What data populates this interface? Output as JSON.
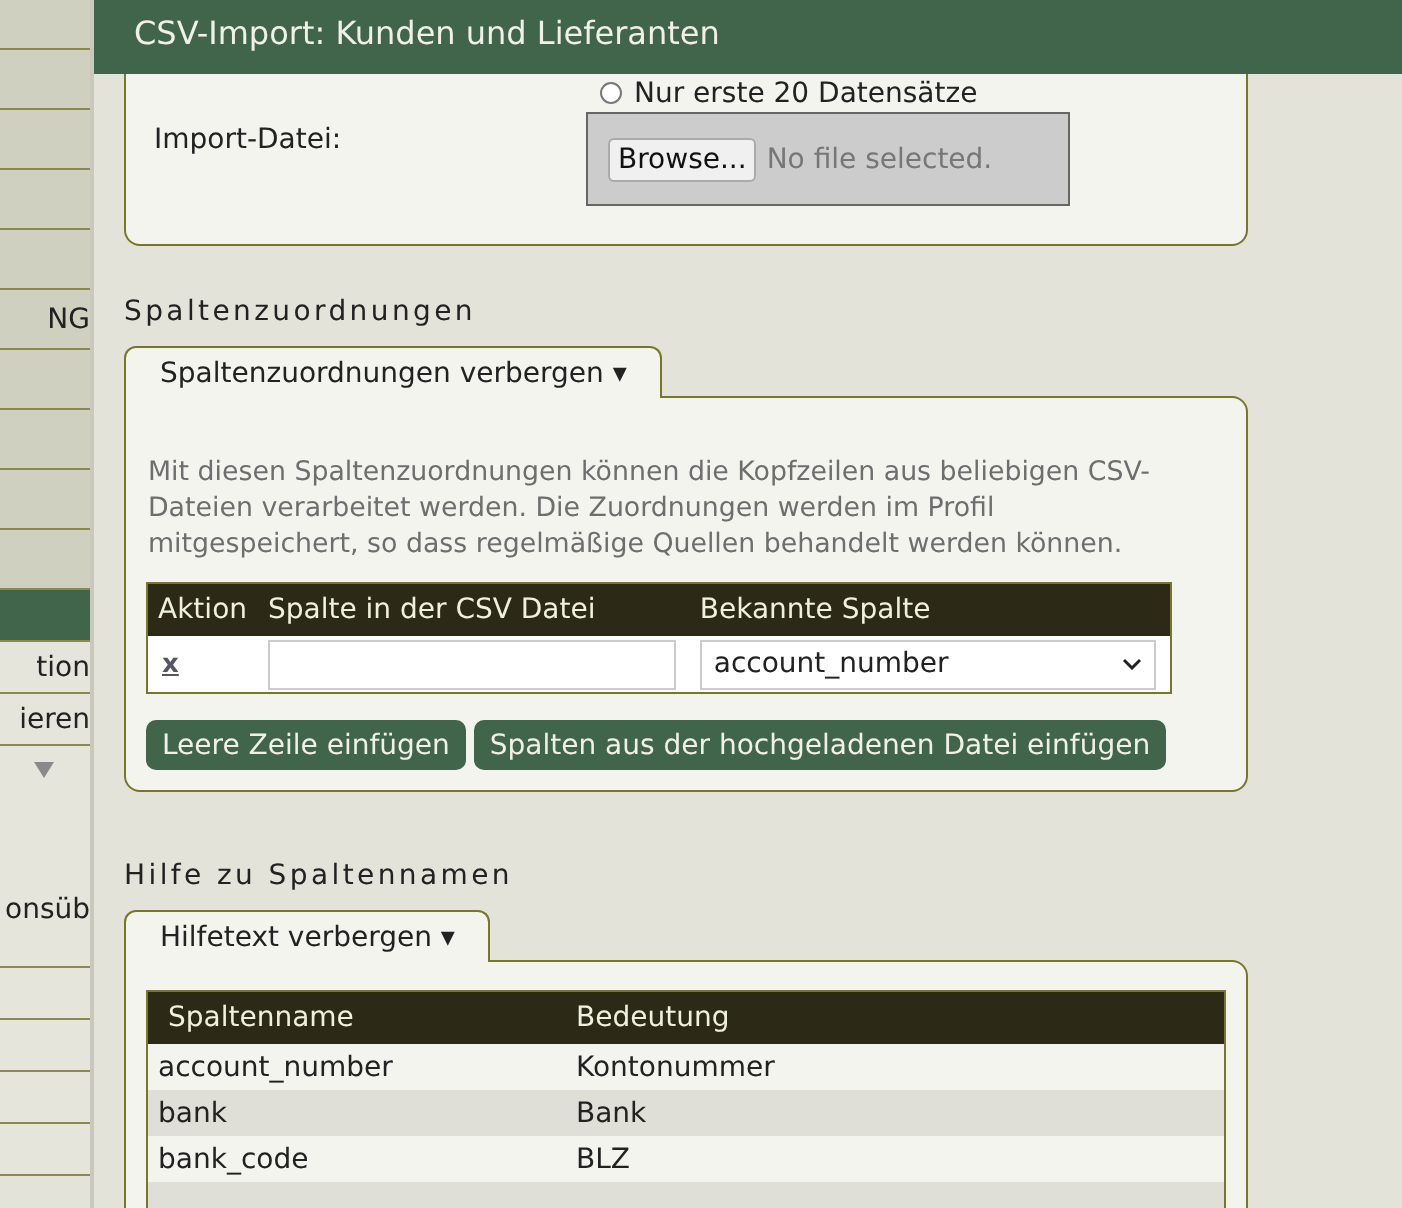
{
  "sidebar": {
    "items": [
      {
        "kind": "item",
        "selected": false
      },
      {
        "kind": "item",
        "selected": false
      },
      {
        "kind": "item",
        "selected": false
      },
      {
        "kind": "item",
        "selected": false
      },
      {
        "kind": "item",
        "selected": false
      },
      {
        "kind": "item",
        "label": "NG",
        "selected": false
      },
      {
        "kind": "item",
        "selected": false
      },
      {
        "kind": "item",
        "selected": false
      },
      {
        "kind": "item",
        "selected": false
      },
      {
        "kind": "item",
        "selected": false
      },
      {
        "kind": "subitem",
        "selected": true
      },
      {
        "kind": "subitem",
        "label": "tion",
        "selected": false
      },
      {
        "kind": "subitem",
        "label": "ieren",
        "selected": false
      },
      {
        "kind": "expander",
        "label": "onsüb",
        "selected": false
      },
      {
        "kind": "subitem",
        "selected": false
      },
      {
        "kind": "subitem",
        "selected": false
      },
      {
        "kind": "subitem",
        "selected": false
      },
      {
        "kind": "subitem",
        "selected": false
      }
    ]
  },
  "page_title": "CSV-Import: Kunden und Lieferanten",
  "import_card": {
    "radio": {
      "label": "Nur erste 20 Datensätze",
      "selected": false
    },
    "file_label": "Import-Datei:",
    "browse_button": "Browse...",
    "file_status": "No file selected."
  },
  "mapping": {
    "heading": "Spaltenzuordnungen",
    "toggle": "Spaltenzuordnungen verbergen ▾",
    "description": "Mit diesen Spaltenzuordnungen können die Kopfzeilen aus beliebigen CSV-Dateien verarbeitet werden. Die Zuordnungen werden im Profil mitgespeichert, so dass regelmäßige Quellen behandelt werden können.",
    "columns": [
      "Aktion",
      "Spalte in der CSV Datei",
      "Bekannte Spalte"
    ],
    "rows": [
      {
        "action": "x",
        "csv_column": "",
        "known_column": "account_number"
      }
    ],
    "buttons": [
      "Leere Zeile einfügen",
      "Spalten aus der hochgeladenen Datei einfügen"
    ]
  },
  "help": {
    "heading": "Hilfe zu Spaltennamen",
    "toggle": "Hilfetext verbergen ▾",
    "columns": [
      "Spaltenname",
      "Bedeutung"
    ],
    "rows": [
      {
        "name": "account_number",
        "meaning": "Kontonummer"
      },
      {
        "name": "bank",
        "meaning": "Bank"
      },
      {
        "name": "bank_code",
        "meaning": "BLZ"
      }
    ]
  }
}
